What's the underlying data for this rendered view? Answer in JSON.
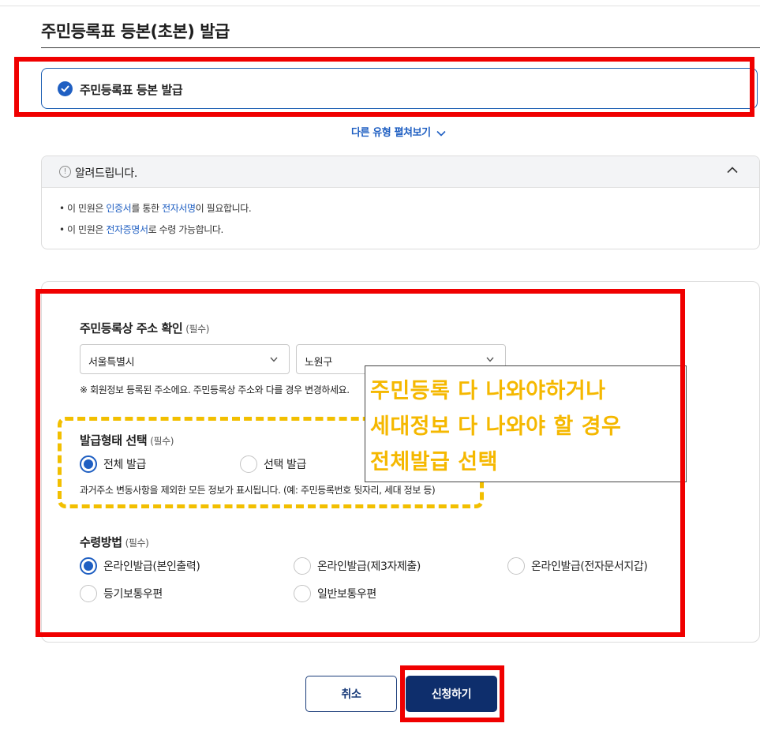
{
  "page": {
    "title": "주민등록표 등본(초본) 발급"
  },
  "issue_type": {
    "selected_label": "주민등록표 등본 발급",
    "more_types_link": "다른 유형 펼쳐보기"
  },
  "notice": {
    "title": "알려드립니다.",
    "line1": {
      "prefix": "이 민원은 ",
      "link1": "인증서",
      "middle": "를 통한 ",
      "link2": "전자서명",
      "suffix": "이 필요합니다."
    },
    "line2": {
      "prefix": "이 민원은 ",
      "link": "전자증명서",
      "suffix": "로 수령 가능합니다."
    }
  },
  "address": {
    "title": "주민등록상 주소 확인",
    "required": "(필수)",
    "sido": "서울특별시",
    "sigungu": "노원구",
    "hint": "※ 회원정보 등록된 주소에요. 주민등록상 주소와 다를 경우 변경하세요."
  },
  "issue_form": {
    "title": "발급형태 선택",
    "required": "(필수)",
    "options": [
      {
        "label": "전체 발급",
        "selected": true
      },
      {
        "label": "선택 발급",
        "selected": false
      }
    ],
    "description": "과거주소 변동사항을 제외한 모든 정보가 표시됩니다. (예: 주민등록번호 뒷자리, 세대 정보 등)"
  },
  "receive_method": {
    "title": "수령방법",
    "required": "(필수)",
    "options": [
      {
        "label": "온라인발급(본인출력)",
        "selected": true
      },
      {
        "label": "온라인발급(제3자제출)",
        "selected": false
      },
      {
        "label": "온라인발급(전자문서지갑)",
        "selected": false
      },
      {
        "label": "등기보통우편",
        "selected": false
      },
      {
        "label": "일반보통우편",
        "selected": false
      }
    ]
  },
  "annotation": {
    "line1": "주민등록 다 나와야하거나",
    "line2": "세대정보 다 나와야 할 경우",
    "line3": "전체발급 선택"
  },
  "buttons": {
    "cancel": "취소",
    "submit": "신청하기"
  },
  "colors": {
    "accent": "#1f5fc2",
    "primary_button": "#0e2e6c",
    "highlight_red": "#f00000",
    "annotation_yellow": "#f5b800"
  }
}
